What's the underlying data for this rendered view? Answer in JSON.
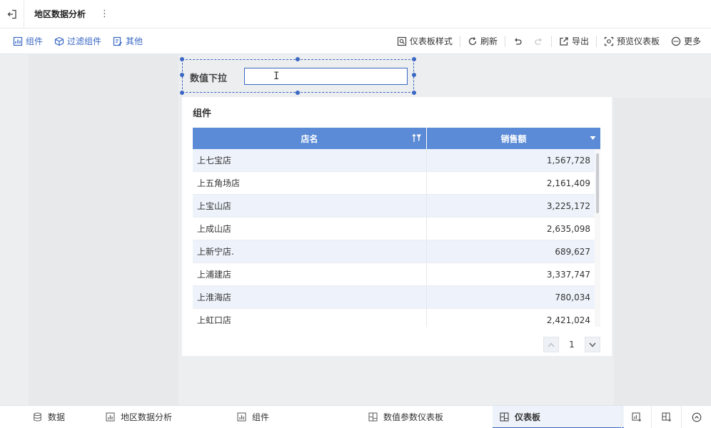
{
  "header": {
    "title": "地区数据分析",
    "more_glyph": "⋮"
  },
  "toolbar": {
    "left": [
      {
        "label": "组件",
        "icon": "chart-component-icon"
      },
      {
        "label": "过滤组件",
        "icon": "filter-cube-icon"
      },
      {
        "label": "其他",
        "icon": "other-edit-icon"
      }
    ],
    "right": [
      {
        "label": "仪表板样式",
        "icon": "dashboard-style-icon"
      },
      {
        "label": "刷新",
        "icon": "refresh-icon"
      },
      {
        "label": "导出",
        "icon": "export-icon"
      },
      {
        "label": "预览仪表板",
        "icon": "preview-icon"
      },
      {
        "label": "更多",
        "icon": "more-icon"
      }
    ]
  },
  "filter_widget": {
    "label": "数值下拉",
    "value": ""
  },
  "table_widget": {
    "title": "组件",
    "columns": [
      "店名",
      "销售额"
    ],
    "rows": [
      [
        "上七宝店",
        "1,567,728"
      ],
      [
        "上五角场店",
        "2,161,409"
      ],
      [
        "上宝山店",
        "3,225,172"
      ],
      [
        "上成山店",
        "2,635,098"
      ],
      [
        "上新宁店.",
        "689,627"
      ],
      [
        "上浦建店",
        "3,337,747"
      ],
      [
        "上淮海店",
        "780,034"
      ],
      [
        "上虹口店",
        "2,421,024"
      ]
    ],
    "page": "1"
  },
  "bottom_tabs": [
    {
      "label": "数据",
      "icon": "database-icon",
      "active": false
    },
    {
      "label": "地区数据分析",
      "icon": "bar-chart-icon",
      "active": false
    },
    {
      "label": "组件",
      "icon": "bar-chart-icon",
      "active": false
    },
    {
      "label": "数值参数仪表板",
      "icon": "dashboard-icon",
      "active": false
    },
    {
      "label": "仪表板",
      "icon": "dashboard-icon",
      "active": true
    }
  ],
  "colors": {
    "accent": "#3a68c4",
    "table_header": "#5b8bd6",
    "row_alt": "#eef3fb",
    "canvas": "#eceeef"
  }
}
